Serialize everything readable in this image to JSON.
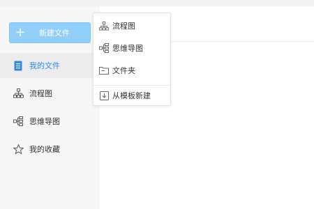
{
  "sidebar": {
    "new_button": {
      "label": "新建文件",
      "plus": "+"
    },
    "items": [
      {
        "label": "我的文件",
        "icon": "document-icon",
        "active": true
      },
      {
        "label": "流程图",
        "icon": "flowchart-icon",
        "active": false
      },
      {
        "label": "思维导图",
        "icon": "mindmap-icon",
        "active": false
      },
      {
        "label": "我的收藏",
        "icon": "star-icon",
        "active": false
      }
    ]
  },
  "dropdown": {
    "items": [
      {
        "label": "流程图",
        "icon": "flowchart-icon"
      },
      {
        "label": "思维导图",
        "icon": "mindmap-icon"
      },
      {
        "label": "文件夹",
        "icon": "folder-icon"
      },
      {
        "label": "从模板新建",
        "icon": "template-import-icon"
      }
    ]
  },
  "colors": {
    "accent": "#2f8ae5",
    "button_bg": "#8fcff9",
    "sidebar_bg": "#f7f7f7"
  }
}
